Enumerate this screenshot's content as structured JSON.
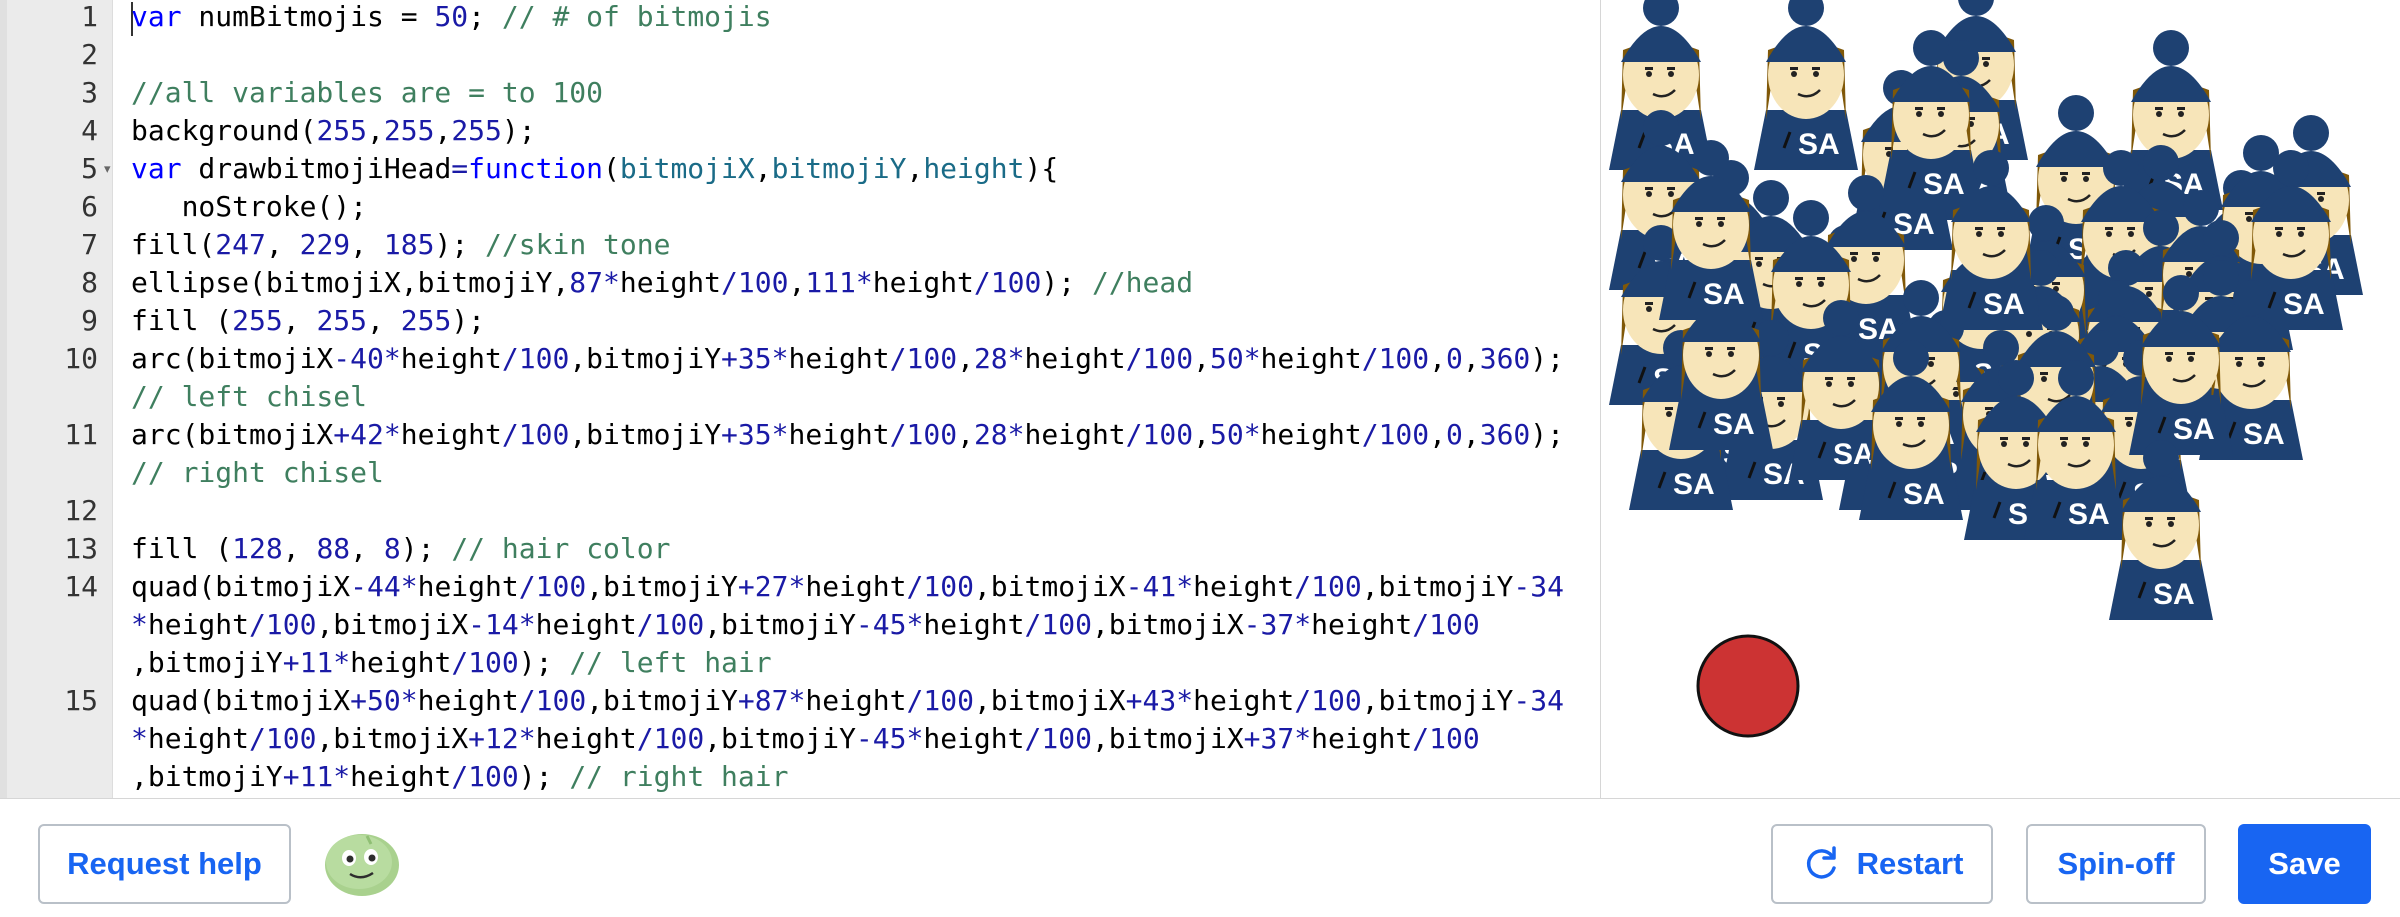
{
  "editor": {
    "line_numbers": [
      "1",
      "2",
      "3",
      "4",
      "5",
      "6",
      "7",
      "8",
      "9",
      "10",
      "11",
      "12",
      "13",
      "14",
      "15"
    ],
    "lines": [
      [
        {
          "t": "var",
          "c": "kw"
        },
        {
          "t": " numBitmojis = ",
          "c": "pl"
        },
        {
          "t": "50",
          "c": "num"
        },
        {
          "t": "; ",
          "c": "pl"
        },
        {
          "t": "// # of bitmojis",
          "c": "cm"
        }
      ],
      [],
      [
        {
          "t": "//all variables are = to 100",
          "c": "cm"
        }
      ],
      [
        {
          "t": "background(",
          "c": "pl"
        },
        {
          "t": "255",
          "c": "num"
        },
        {
          "t": ",",
          "c": "pl"
        },
        {
          "t": "255",
          "c": "num"
        },
        {
          "t": ",",
          "c": "pl"
        },
        {
          "t": "255",
          "c": "num"
        },
        {
          "t": ");",
          "c": "pl"
        }
      ],
      [
        {
          "t": "var",
          "c": "kw"
        },
        {
          "t": " drawbitmojiHead",
          "c": "pl"
        },
        {
          "t": "=",
          "c": "op"
        },
        {
          "t": "function",
          "c": "kw"
        },
        {
          "t": "(",
          "c": "pl"
        },
        {
          "t": "bitmojiX",
          "c": "var"
        },
        {
          "t": ",",
          "c": "pl"
        },
        {
          "t": "bitmojiY",
          "c": "var"
        },
        {
          "t": ",",
          "c": "pl"
        },
        {
          "t": "height",
          "c": "var"
        },
        {
          "t": "){",
          "c": "pl"
        }
      ],
      [
        {
          "t": "   noStroke();",
          "c": "pl"
        }
      ],
      [
        {
          "t": "fill(",
          "c": "pl"
        },
        {
          "t": "247",
          "c": "num"
        },
        {
          "t": ", ",
          "c": "pl"
        },
        {
          "t": "229",
          "c": "num"
        },
        {
          "t": ", ",
          "c": "pl"
        },
        {
          "t": "185",
          "c": "num"
        },
        {
          "t": "); ",
          "c": "pl"
        },
        {
          "t": "//skin tone",
          "c": "cm"
        }
      ],
      [
        {
          "t": "ellipse(bitmojiX,bitmojiY,",
          "c": "pl"
        },
        {
          "t": "87",
          "c": "num"
        },
        {
          "t": "*",
          "c": "op"
        },
        {
          "t": "height",
          "c": "pl"
        },
        {
          "t": "/",
          "c": "op"
        },
        {
          "t": "100",
          "c": "num"
        },
        {
          "t": ",",
          "c": "pl"
        },
        {
          "t": "111",
          "c": "num"
        },
        {
          "t": "*",
          "c": "op"
        },
        {
          "t": "height",
          "c": "pl"
        },
        {
          "t": "/",
          "c": "op"
        },
        {
          "t": "100",
          "c": "num"
        },
        {
          "t": "); ",
          "c": "pl"
        },
        {
          "t": "//head",
          "c": "cm"
        }
      ],
      [
        {
          "t": "fill (",
          "c": "pl"
        },
        {
          "t": "255",
          "c": "num"
        },
        {
          "t": ", ",
          "c": "pl"
        },
        {
          "t": "255",
          "c": "num"
        },
        {
          "t": ", ",
          "c": "pl"
        },
        {
          "t": "255",
          "c": "num"
        },
        {
          "t": ");",
          "c": "pl"
        }
      ],
      [
        {
          "t": "arc(bitmojiX",
          "c": "pl"
        },
        {
          "t": "-40",
          "c": "num"
        },
        {
          "t": "*",
          "c": "op"
        },
        {
          "t": "height",
          "c": "pl"
        },
        {
          "t": "/",
          "c": "op"
        },
        {
          "t": "100",
          "c": "num"
        },
        {
          "t": ",bitmojiY",
          "c": "pl"
        },
        {
          "t": "+35",
          "c": "num"
        },
        {
          "t": "*",
          "c": "op"
        },
        {
          "t": "height",
          "c": "pl"
        },
        {
          "t": "/",
          "c": "op"
        },
        {
          "t": "100",
          "c": "num"
        },
        {
          "t": ",",
          "c": "pl"
        },
        {
          "t": "28",
          "c": "num"
        },
        {
          "t": "*",
          "c": "op"
        },
        {
          "t": "height",
          "c": "pl"
        },
        {
          "t": "/",
          "c": "op"
        },
        {
          "t": "100",
          "c": "num"
        },
        {
          "t": ",",
          "c": "pl"
        },
        {
          "t": "50",
          "c": "num"
        },
        {
          "t": "*",
          "c": "op"
        },
        {
          "t": "height",
          "c": "pl"
        },
        {
          "t": "/",
          "c": "op"
        },
        {
          "t": "100",
          "c": "num"
        },
        {
          "t": ",",
          "c": "pl"
        },
        {
          "t": "0",
          "c": "num"
        },
        {
          "t": ",",
          "c": "pl"
        },
        {
          "t": "360",
          "c": "num"
        },
        {
          "t": ");",
          "c": "pl"
        }
      ],
      [
        {
          "t": "// left chisel",
          "c": "cm"
        }
      ],
      [
        {
          "t": "arc(bitmojiX",
          "c": "pl"
        },
        {
          "t": "+42",
          "c": "num"
        },
        {
          "t": "*",
          "c": "op"
        },
        {
          "t": "height",
          "c": "pl"
        },
        {
          "t": "/",
          "c": "op"
        },
        {
          "t": "100",
          "c": "num"
        },
        {
          "t": ",bitmojiY",
          "c": "pl"
        },
        {
          "t": "+35",
          "c": "num"
        },
        {
          "t": "*",
          "c": "op"
        },
        {
          "t": "height",
          "c": "pl"
        },
        {
          "t": "/",
          "c": "op"
        },
        {
          "t": "100",
          "c": "num"
        },
        {
          "t": ",",
          "c": "pl"
        },
        {
          "t": "28",
          "c": "num"
        },
        {
          "t": "*",
          "c": "op"
        },
        {
          "t": "height",
          "c": "pl"
        },
        {
          "t": "/",
          "c": "op"
        },
        {
          "t": "100",
          "c": "num"
        },
        {
          "t": ",",
          "c": "pl"
        },
        {
          "t": "50",
          "c": "num"
        },
        {
          "t": "*",
          "c": "op"
        },
        {
          "t": "height",
          "c": "pl"
        },
        {
          "t": "/",
          "c": "op"
        },
        {
          "t": "100",
          "c": "num"
        },
        {
          "t": ",",
          "c": "pl"
        },
        {
          "t": "0",
          "c": "num"
        },
        {
          "t": ",",
          "c": "pl"
        },
        {
          "t": "360",
          "c": "num"
        },
        {
          "t": ");",
          "c": "pl"
        }
      ],
      [
        {
          "t": "// right chisel",
          "c": "cm"
        }
      ],
      [],
      [
        {
          "t": "fill (",
          "c": "pl"
        },
        {
          "t": "128",
          "c": "num"
        },
        {
          "t": ", ",
          "c": "pl"
        },
        {
          "t": "88",
          "c": "num"
        },
        {
          "t": ", ",
          "c": "pl"
        },
        {
          "t": "8",
          "c": "num"
        },
        {
          "t": "); ",
          "c": "pl"
        },
        {
          "t": "// hair color",
          "c": "cm"
        }
      ],
      [
        {
          "t": "quad(bitmojiX",
          "c": "pl"
        },
        {
          "t": "-44",
          "c": "num"
        },
        {
          "t": "*",
          "c": "op"
        },
        {
          "t": "height",
          "c": "pl"
        },
        {
          "t": "/",
          "c": "op"
        },
        {
          "t": "100",
          "c": "num"
        },
        {
          "t": ",bitmojiY",
          "c": "pl"
        },
        {
          "t": "+27",
          "c": "num"
        },
        {
          "t": "*",
          "c": "op"
        },
        {
          "t": "height",
          "c": "pl"
        },
        {
          "t": "/",
          "c": "op"
        },
        {
          "t": "100",
          "c": "num"
        },
        {
          "t": ",bitmojiX",
          "c": "pl"
        },
        {
          "t": "-41",
          "c": "num"
        },
        {
          "t": "*",
          "c": "op"
        },
        {
          "t": "height",
          "c": "pl"
        },
        {
          "t": "/",
          "c": "op"
        },
        {
          "t": "100",
          "c": "num"
        },
        {
          "t": ",bitmojiY",
          "c": "pl"
        },
        {
          "t": "-34",
          "c": "num"
        }
      ],
      [
        {
          "t": "*",
          "c": "op"
        },
        {
          "t": "height",
          "c": "pl"
        },
        {
          "t": "/",
          "c": "op"
        },
        {
          "t": "100",
          "c": "num"
        },
        {
          "t": ",bitmojiX",
          "c": "pl"
        },
        {
          "t": "-14",
          "c": "num"
        },
        {
          "t": "*",
          "c": "op"
        },
        {
          "t": "height",
          "c": "pl"
        },
        {
          "t": "/",
          "c": "op"
        },
        {
          "t": "100",
          "c": "num"
        },
        {
          "t": ",bitmojiY",
          "c": "pl"
        },
        {
          "t": "-45",
          "c": "num"
        },
        {
          "t": "*",
          "c": "op"
        },
        {
          "t": "height",
          "c": "pl"
        },
        {
          "t": "/",
          "c": "op"
        },
        {
          "t": "100",
          "c": "num"
        },
        {
          "t": ",bitmojiX",
          "c": "pl"
        },
        {
          "t": "-37",
          "c": "num"
        },
        {
          "t": "*",
          "c": "op"
        },
        {
          "t": "height",
          "c": "pl"
        },
        {
          "t": "/",
          "c": "op"
        },
        {
          "t": "100",
          "c": "num"
        }
      ],
      [
        {
          "t": ",bitmojiY",
          "c": "pl"
        },
        {
          "t": "+11",
          "c": "num"
        },
        {
          "t": "*",
          "c": "op"
        },
        {
          "t": "height",
          "c": "pl"
        },
        {
          "t": "/",
          "c": "op"
        },
        {
          "t": "100",
          "c": "num"
        },
        {
          "t": "); ",
          "c": "pl"
        },
        {
          "t": "// left hair",
          "c": "cm"
        }
      ],
      [
        {
          "t": "quad(bitmojiX",
          "c": "pl"
        },
        {
          "t": "+50",
          "c": "num"
        },
        {
          "t": "*",
          "c": "op"
        },
        {
          "t": "height",
          "c": "pl"
        },
        {
          "t": "/",
          "c": "op"
        },
        {
          "t": "100",
          "c": "num"
        },
        {
          "t": ",bitmojiY",
          "c": "pl"
        },
        {
          "t": "+87",
          "c": "num"
        },
        {
          "t": "*",
          "c": "op"
        },
        {
          "t": "height",
          "c": "pl"
        },
        {
          "t": "/",
          "c": "op"
        },
        {
          "t": "100",
          "c": "num"
        },
        {
          "t": ",bitmojiX",
          "c": "pl"
        },
        {
          "t": "+43",
          "c": "num"
        },
        {
          "t": "*",
          "c": "op"
        },
        {
          "t": "height",
          "c": "pl"
        },
        {
          "t": "/",
          "c": "op"
        },
        {
          "t": "100",
          "c": "num"
        },
        {
          "t": ",bitmojiY",
          "c": "pl"
        },
        {
          "t": "-34",
          "c": "num"
        }
      ],
      [
        {
          "t": "*",
          "c": "op"
        },
        {
          "t": "height",
          "c": "pl"
        },
        {
          "t": "/",
          "c": "op"
        },
        {
          "t": "100",
          "c": "num"
        },
        {
          "t": ",bitmojiX",
          "c": "pl"
        },
        {
          "t": "+12",
          "c": "num"
        },
        {
          "t": "*",
          "c": "op"
        },
        {
          "t": "height",
          "c": "pl"
        },
        {
          "t": "/",
          "c": "op"
        },
        {
          "t": "100",
          "c": "num"
        },
        {
          "t": ",bitmojiY",
          "c": "pl"
        },
        {
          "t": "-45",
          "c": "num"
        },
        {
          "t": "*",
          "c": "op"
        },
        {
          "t": "height",
          "c": "pl"
        },
        {
          "t": "/",
          "c": "op"
        },
        {
          "t": "100",
          "c": "num"
        },
        {
          "t": ",bitmojiX",
          "c": "pl"
        },
        {
          "t": "+37",
          "c": "num"
        },
        {
          "t": "*",
          "c": "op"
        },
        {
          "t": "height",
          "c": "pl"
        },
        {
          "t": "/",
          "c": "op"
        },
        {
          "t": "100",
          "c": "num"
        }
      ],
      [
        {
          "t": ",bitmojiY",
          "c": "pl"
        },
        {
          "t": "+11",
          "c": "num"
        },
        {
          "t": "*",
          "c": "op"
        },
        {
          "t": "height",
          "c": "pl"
        },
        {
          "t": "/",
          "c": "op"
        },
        {
          "t": "100",
          "c": "num"
        },
        {
          "t": "); ",
          "c": "pl"
        },
        {
          "t": "// right hair",
          "c": "cm"
        }
      ]
    ],
    "colors": {
      "kw": "#0000ff",
      "num": "#1a1aa6",
      "cm": "#3f7f5f",
      "var": "#1a6b87",
      "op": "#1a1aa6",
      "pl": "#000000"
    }
  },
  "canvas": {
    "background": "#ffffff",
    "bitmoji_label": "SA",
    "bitmoji_count": 50,
    "colors": {
      "skin": "#f7e5b9",
      "hat": "#1e4172",
      "hair": "#805808",
      "shirt": "#1e4172",
      "ball": "#cc3333"
    }
  },
  "bottom_bar": {
    "request_help_label": "Request help",
    "restart_label": "Restart",
    "spinoff_label": "Spin-off",
    "save_label": "Save"
  },
  "accent": "#1865f2"
}
